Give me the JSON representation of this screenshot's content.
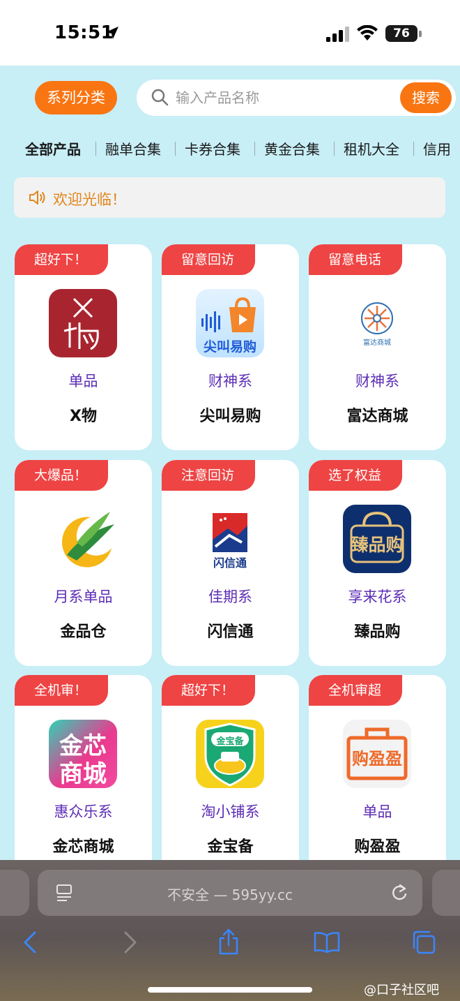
{
  "status_bar": {
    "time": "15:51",
    "battery": "76"
  },
  "header": {
    "series_button": "系列分类",
    "search_placeholder": "输入产品名称",
    "search_button": "搜索"
  },
  "tabs": [
    {
      "label": "全部产品",
      "active": true
    },
    {
      "label": "融单合集",
      "active": false
    },
    {
      "label": "卡券合集",
      "active": false
    },
    {
      "label": "黄金合集",
      "active": false
    },
    {
      "label": "租机大全",
      "active": false
    },
    {
      "label": "信用",
      "active": false
    }
  ],
  "notice": {
    "text": "欢迎光临！"
  },
  "products": [
    {
      "tag": "超好下！",
      "series": "单品",
      "name": "X物",
      "logo": "x-wu-logo"
    },
    {
      "tag": "留意回访",
      "series": "财神系",
      "name": "尖叫易购",
      "logo": "jianjiao-yigou-logo"
    },
    {
      "tag": "留意电话",
      "series": "财神系",
      "name": "富达商城",
      "logo": "fuda-mall-logo"
    },
    {
      "tag": "大爆品！",
      "series": "月系单品",
      "name": "金品仓",
      "logo": "jinpincang-logo"
    },
    {
      "tag": "注意回访",
      "series": "佳期系",
      "name": "闪信通",
      "logo": "shanxintong-logo"
    },
    {
      "tag": "选了权益",
      "series": "享来花系",
      "name": "臻品购",
      "logo": "zhenpingou-logo"
    },
    {
      "tag": "全机审！",
      "series": "惠众乐系",
      "name": "金芯商城",
      "logo": "jinxin-mall-logo"
    },
    {
      "tag": "超好下！",
      "series": "淘小铺系",
      "name": "金宝备",
      "logo": "jinbaobei-logo"
    },
    {
      "tag": "全机审超",
      "series": "单品",
      "name": "购盈盈",
      "logo": "gouyingying-logo"
    }
  ],
  "logo_text": {
    "x_wu": "X\n物",
    "jianjiao": "尖叫易购",
    "fuda": "富达商城",
    "shanxintong": "闪信通",
    "zhenpingou": "臻品购",
    "jinxin_top": "金芯",
    "jinxin_bottom": "商城",
    "jinbaobei": "金宝备",
    "gouyingying": "购盈盈"
  },
  "browser": {
    "url": "不安全 — 595yy.cc"
  },
  "watermark": "@口子社区吧",
  "colors": {
    "accent_orange": "#f97512",
    "tag_red": "#ee4444",
    "series_purple": "#5c2db5",
    "page_bg": "#c8eef6",
    "notice_text": "#e0861b"
  }
}
